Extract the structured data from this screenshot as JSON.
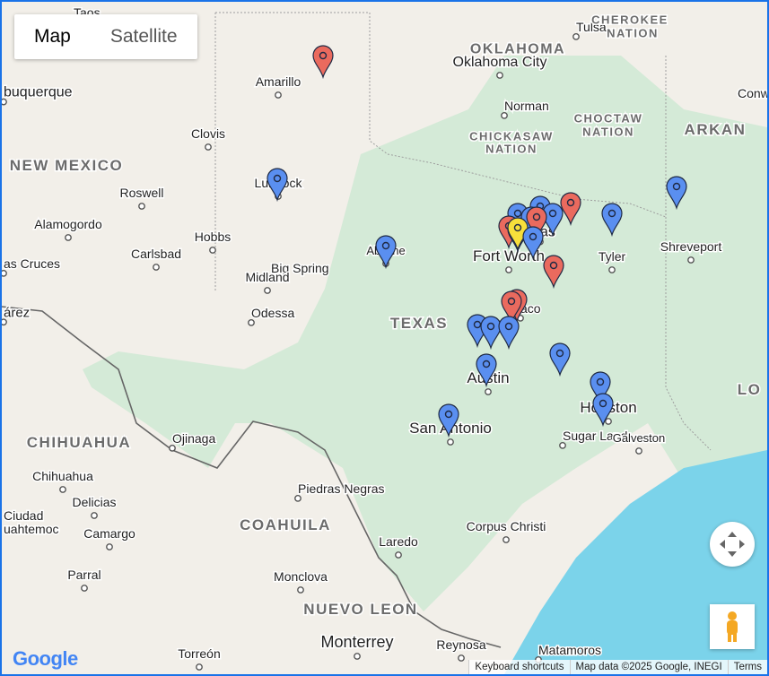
{
  "map_type": {
    "map_label": "Map",
    "satellite_label": "Satellite"
  },
  "places": [
    {
      "id": "taos",
      "label": "Taos",
      "dot": false
    },
    {
      "id": "tulsa",
      "label": "Tulsa",
      "dot": true
    },
    {
      "id": "cherokee",
      "label": "CHEROKEE",
      "dot": false
    },
    {
      "id": "nation1",
      "label": "NATION",
      "dot": false
    },
    {
      "id": "oklahoma",
      "label": "OKLAHOMA",
      "dot": false
    },
    {
      "id": "okc",
      "label": "Oklahoma City",
      "dot": true
    },
    {
      "id": "amarillo",
      "label": "Amarillo",
      "dot": true
    },
    {
      "id": "albuquerque",
      "label": "buquerque",
      "dot": true
    },
    {
      "id": "norman",
      "label": "Norman",
      "dot": true
    },
    {
      "id": "conway",
      "label": "Conw",
      "dot": false
    },
    {
      "id": "choctaw",
      "label": "CHOCTAW",
      "dot": false
    },
    {
      "id": "nation2",
      "label": "NATION",
      "dot": false
    },
    {
      "id": "arkansas",
      "label": "ARKAN",
      "dot": false
    },
    {
      "id": "chickasaw",
      "label": "CHICKASAW",
      "dot": false
    },
    {
      "id": "nation3",
      "label": "NATION",
      "dot": false
    },
    {
      "id": "clovis",
      "label": "Clovis",
      "dot": true
    },
    {
      "id": "newmexico",
      "label": "NEW MEXICO",
      "dot": false
    },
    {
      "id": "lubbock",
      "label": "Lubbock",
      "dot": true
    },
    {
      "id": "roswell",
      "label": "Roswell",
      "dot": true
    },
    {
      "id": "alamogordo",
      "label": "Alamogordo",
      "dot": true
    },
    {
      "id": "hobbs",
      "label": "Hobbs",
      "dot": true
    },
    {
      "id": "abilene",
      "label": "Abilene",
      "dot": true
    },
    {
      "id": "fortworth",
      "label": "Fort Worth",
      "dot": true
    },
    {
      "id": "dallas",
      "label": "as",
      "dot": true
    },
    {
      "id": "tyler",
      "label": "Tyler",
      "dot": true
    },
    {
      "id": "shreveport",
      "label": "Shreveport",
      "dot": true
    },
    {
      "id": "lascruces",
      "label": "as Cruces",
      "dot": true
    },
    {
      "id": "carlsbad",
      "label": "Carlsbad",
      "dot": true
    },
    {
      "id": "bigspring",
      "label": "Big Spring",
      "dot": true
    },
    {
      "id": "midland",
      "label": "Midland",
      "dot": true
    },
    {
      "id": "odessa",
      "label": "Odessa",
      "dot": true
    },
    {
      "id": "juarez",
      "label": "árez",
      "dot": true
    },
    {
      "id": "waco",
      "label": "aco",
      "dot": true
    },
    {
      "id": "texas",
      "label": "TEXAS",
      "dot": false
    },
    {
      "id": "austin",
      "label": "Austin",
      "dot": true
    },
    {
      "id": "houston",
      "label": "Houston",
      "dot": true
    },
    {
      "id": "louisiana",
      "label": "LO",
      "dot": false
    },
    {
      "id": "chihuahua_state",
      "label": "CHIHUAHUA",
      "dot": false
    },
    {
      "id": "ojinaga",
      "label": "Ojinaga",
      "dot": true
    },
    {
      "id": "sanantonio",
      "label": "San Antonio",
      "dot": true
    },
    {
      "id": "sugarland",
      "label": "Sugar Land",
      "dot": true
    },
    {
      "id": "galveston",
      "label": "Galveston",
      "dot": true
    },
    {
      "id": "chihuahua",
      "label": "Chihuahua",
      "dot": true
    },
    {
      "id": "delicias",
      "label": "Delicias",
      "dot": true
    },
    {
      "id": "ciudad",
      "label": "Ciudad",
      "dot": false
    },
    {
      "id": "uahtemoc",
      "label": "uahtemoc",
      "dot": false
    },
    {
      "id": "piedras",
      "label": "Piedras Negras",
      "dot": true
    },
    {
      "id": "coahuila",
      "label": "COAHUILA",
      "dot": false
    },
    {
      "id": "camargo",
      "label": "Camargo",
      "dot": true
    },
    {
      "id": "laredo",
      "label": "Laredo",
      "dot": true
    },
    {
      "id": "corpus",
      "label": "Corpus Christi",
      "dot": true
    },
    {
      "id": "parral",
      "label": "Parral",
      "dot": true
    },
    {
      "id": "monclova",
      "label": "Monclova",
      "dot": true
    },
    {
      "id": "nuevoleon",
      "label": "NUEVO LEON",
      "dot": false
    },
    {
      "id": "torreon",
      "label": "Torreón",
      "dot": true
    },
    {
      "id": "monterrey",
      "label": "Monterrey",
      "dot": true
    },
    {
      "id": "reynosa",
      "label": "Reynosa",
      "dot": true
    },
    {
      "id": "matamoros",
      "label": "Matamoros",
      "dot": true
    }
  ],
  "markers": [
    {
      "color": "red"
    },
    {
      "color": "blue"
    },
    {
      "color": "blue"
    },
    {
      "color": "blue"
    },
    {
      "color": "blue"
    },
    {
      "color": "red"
    },
    {
      "color": "blue"
    },
    {
      "color": "red"
    },
    {
      "color": "blue"
    },
    {
      "color": "red"
    },
    {
      "color": "yellow"
    },
    {
      "color": "blue"
    },
    {
      "color": "blue"
    },
    {
      "color": "blue"
    },
    {
      "color": "blue"
    },
    {
      "color": "red"
    },
    {
      "color": "red"
    },
    {
      "color": "red"
    },
    {
      "color": "blue"
    },
    {
      "color": "blue"
    },
    {
      "color": "blue"
    },
    {
      "color": "blue"
    },
    {
      "color": "blue"
    },
    {
      "color": "blue"
    },
    {
      "color": "blue"
    },
    {
      "color": "blue"
    }
  ],
  "marker_colors": {
    "red": "#ea6a5e",
    "blue": "#5a8ff0",
    "yellow": "#f7df3b"
  },
  "footer": {
    "shortcuts": "Keyboard shortcuts",
    "mapdata": "Map data ©2025 Google, INEGI",
    "terms": "Terms"
  },
  "logo": "Google",
  "icons": {
    "pan": "move-arrows-icon",
    "pegman": "pegman-icon"
  }
}
